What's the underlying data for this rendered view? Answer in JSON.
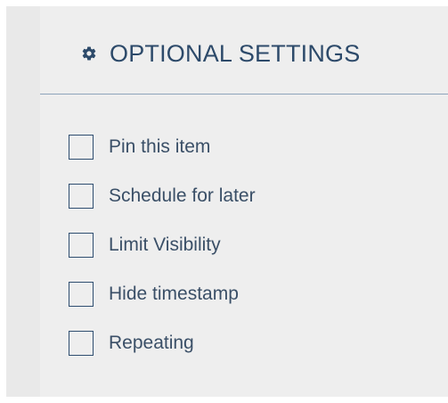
{
  "panel": {
    "title": "OPTIONAL SETTINGS",
    "title_icon": "gear-icon",
    "options": [
      {
        "label": "Pin this item",
        "checked": false
      },
      {
        "label": "Schedule for later",
        "checked": false
      },
      {
        "label": "Limit Visibility",
        "checked": false
      },
      {
        "label": "Hide timestamp",
        "checked": false
      },
      {
        "label": "Repeating",
        "checked": false
      }
    ]
  },
  "colors": {
    "title_text": "#2d4a6a",
    "divider": "#8ea4bb",
    "checkbox_border": "#2f4e70",
    "panel_background": "#eeeeee"
  }
}
